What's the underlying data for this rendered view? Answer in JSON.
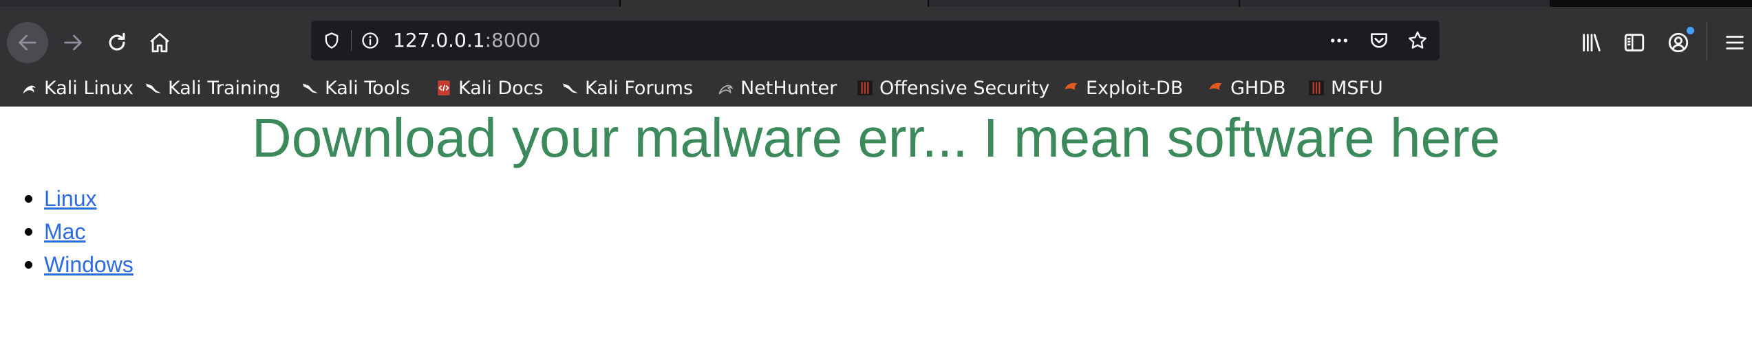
{
  "browser": {
    "url_host": "127.0.0.1",
    "url_port": ":8000",
    "bookmarks": [
      {
        "label": "Kali Linux",
        "icon": "kali-dragon-icon"
      },
      {
        "label": "Kali Training",
        "icon": "kali-dragon-icon"
      },
      {
        "label": "Kali Tools",
        "icon": "kali-dragon-icon"
      },
      {
        "label": "Kali Docs",
        "icon": "kali-docs-icon"
      },
      {
        "label": "Kali Forums",
        "icon": "kali-dragon-icon"
      },
      {
        "label": "NetHunter",
        "icon": "nethunter-icon"
      },
      {
        "label": "Offensive Security",
        "icon": "offsec-icon"
      },
      {
        "label": "Exploit-DB",
        "icon": "exploitdb-icon"
      },
      {
        "label": "GHDB",
        "icon": "exploitdb-icon"
      },
      {
        "label": "MSFU",
        "icon": "offsec-icon"
      }
    ]
  },
  "page": {
    "heading": "Download your malware err... I mean software here",
    "links": [
      {
        "label": "Linux"
      },
      {
        "label": "Mac"
      },
      {
        "label": "Windows"
      }
    ]
  },
  "colors": {
    "heading": "#3c8a5b",
    "link": "#2b6be0",
    "toolbar": "#323234",
    "urlbar": "#1c1b22"
  }
}
